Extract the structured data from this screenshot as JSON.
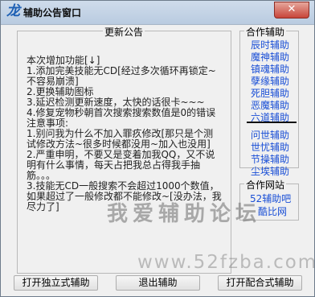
{
  "window": {
    "title": "辅助公告窗口",
    "close_label": "✕",
    "icon_glyph": "龙"
  },
  "notice": {
    "group_label": "更新公告",
    "text": "本次增加功能[↓]\n1.添加完美技能无CD[经过多次循环再锁定~不容易崩溃]\n2.更换辅助图标\n3.延迟检测更新速度，太快的话很卡~~~\n4.修复宠物秒朝首次搜索搜索数值是0的错误\n注意事项:\n1.别问我为什么不加入罪疚修改[那只是个测试修改方法~很多时候都没用~加入也没用]\n2.严重申明，不要又是变着加我QQ，又不说明有什么事情，每天占把我总占得我手抽筋。。。\n3.技能无CD一般搜索不会超过1000个数值，如果超过了一般修改都不能修改~[没办法，我尽力了]"
  },
  "sidebar": {
    "helpers_label": "合作辅助",
    "helpers": [
      "辰时辅助",
      "魔神辅助",
      "镇魂辅助",
      "孽缘辅助",
      "死胆辅助",
      "恶魔辅助",
      "六道辅助"
    ],
    "helpers2": [
      "问世辅助",
      "世忧辅助",
      "节操辅助",
      "尘埃辅助"
    ],
    "sites_label": "合作网站",
    "sites": [
      "52辅助吧",
      "酷比网"
    ]
  },
  "footer": {
    "open_standalone": "打开独立式辅助",
    "exit": "退出辅助",
    "open_combined": "打开配合式辅助"
  },
  "watermark": {
    "text": "我爱辅助论坛",
    "url": "www.52fzba.com"
  },
  "colors": {
    "link": "#1a4fd6",
    "titlebar": "#c2d3e6",
    "close": "#c8453a"
  }
}
